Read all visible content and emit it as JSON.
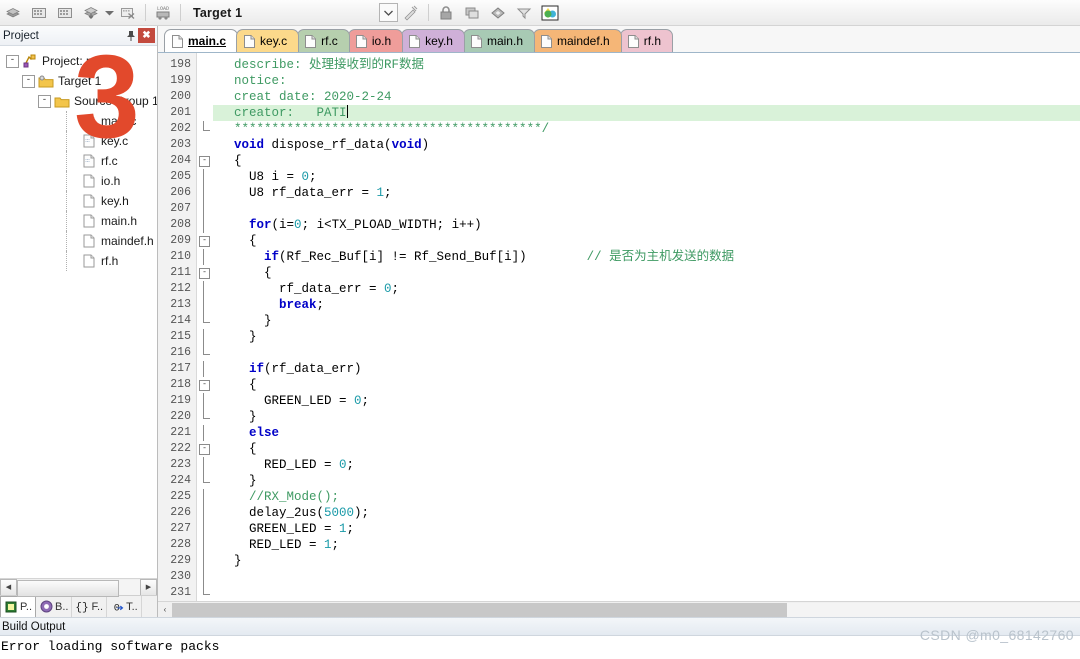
{
  "toolbar": {
    "icons": [
      {
        "name": "translate-icon",
        "glyph": "layers"
      },
      {
        "name": "build-target-icon",
        "glyph": "build"
      },
      {
        "name": "rebuild-icon",
        "glyph": "rebuild"
      },
      {
        "name": "batch-build-icon",
        "glyph": "batch"
      },
      {
        "name": "batch-build-dropdown-icon",
        "glyph": "caret"
      },
      {
        "name": "stop-build-icon",
        "glyph": "stop"
      },
      {
        "name": "download-icon",
        "glyph": "LOAD"
      }
    ],
    "target_label": "Target 1",
    "combo_arrow_icon": "chevron-down-icon",
    "right_icons": [
      {
        "name": "target-options-icon",
        "glyph": "magic"
      },
      {
        "name": "manage-project-items-icon",
        "glyph": "lock"
      },
      {
        "name": "manage-components-icon",
        "glyph": "windows"
      },
      {
        "name": "pack-installer-icon",
        "glyph": "diamond"
      },
      {
        "name": "configure-flash-icon",
        "glyph": "funnel"
      },
      {
        "name": "events-viewer-icon",
        "glyph": "globe"
      }
    ]
  },
  "project_panel": {
    "title": "Project",
    "pin_icon": "pin-icon",
    "close_label": "✖",
    "tree": [
      {
        "label": "Project: main",
        "level": 1,
        "expander": "-",
        "icon": "project-icon"
      },
      {
        "label": "Target 1",
        "level": 2,
        "expander": "-",
        "icon": "target-folder-icon"
      },
      {
        "label": "Source Group 1",
        "level": 3,
        "expander": "-",
        "icon": "folder-icon"
      },
      {
        "label": "main.c",
        "level": 4,
        "expander": "",
        "icon": "c-file-icon"
      },
      {
        "label": "key.c",
        "level": 4,
        "expander": "",
        "icon": "c-file-icon"
      },
      {
        "label": "rf.c",
        "level": 4,
        "expander": "",
        "icon": "c-file-icon"
      },
      {
        "label": "io.h",
        "level": 4,
        "expander": "",
        "icon": "h-file-icon"
      },
      {
        "label": "key.h",
        "level": 4,
        "expander": "",
        "icon": "h-file-icon"
      },
      {
        "label": "main.h",
        "level": 4,
        "expander": "",
        "icon": "h-file-icon"
      },
      {
        "label": "maindef.h",
        "level": 4,
        "expander": "",
        "icon": "h-file-icon"
      },
      {
        "label": "rf.h",
        "level": 4,
        "expander": "",
        "icon": "h-file-icon"
      }
    ],
    "bottom_tabs": [
      {
        "label": "P..",
        "name": "project-tab",
        "active": true,
        "icon": "project-small-icon"
      },
      {
        "label": "B..",
        "name": "books-tab",
        "active": false,
        "icon": "books-icon"
      },
      {
        "label": "F..",
        "name": "functions-tab",
        "active": false,
        "icon": "braces-icon"
      },
      {
        "label": "T..",
        "name": "templates-tab",
        "active": false,
        "icon": "template-icon"
      }
    ],
    "scroll_left_arrow": "◀",
    "scroll_right_arrow": "▶"
  },
  "editor": {
    "tabs": [
      {
        "label": "main.c",
        "color": "#ffffff",
        "active": true
      },
      {
        "label": "key.c",
        "color": "#fcd98b",
        "active": false
      },
      {
        "label": "rf.c",
        "color": "#b6cfae",
        "active": false
      },
      {
        "label": "io.h",
        "color": "#ef9d9a",
        "active": false
      },
      {
        "label": "key.h",
        "color": "#cfb0d8",
        "active": false
      },
      {
        "label": "main.h",
        "color": "#a8cab4",
        "active": false
      },
      {
        "label": "maindef.h",
        "color": "#f5b677",
        "active": false
      },
      {
        "label": "rf.h",
        "color": "#eec3cf",
        "active": false
      }
    ],
    "first_line_number": 198,
    "lines": [
      {
        "n": 198,
        "fold": "",
        "current": false,
        "spans": [
          {
            "t": "  ",
            "s": "t"
          },
          {
            "t": "describe: 处理接收到的RF数据",
            "s": "c"
          }
        ]
      },
      {
        "n": 199,
        "fold": "",
        "current": false,
        "spans": [
          {
            "t": "  ",
            "s": "t"
          },
          {
            "t": "notice:",
            "s": "c"
          }
        ]
      },
      {
        "n": 200,
        "fold": "",
        "current": false,
        "spans": [
          {
            "t": "  ",
            "s": "t"
          },
          {
            "t": "creat date: 2020-2-24",
            "s": "c"
          }
        ]
      },
      {
        "n": 201,
        "fold": "",
        "current": true,
        "spans": [
          {
            "t": "  ",
            "s": "t"
          },
          {
            "t": "creator:   PATI",
            "s": "c"
          },
          {
            "t": "|cursor|",
            "s": "cursor"
          }
        ]
      },
      {
        "n": 202,
        "fold": "end",
        "current": false,
        "spans": [
          {
            "t": "  ",
            "s": "t"
          },
          {
            "t": "*****************************************/",
            "s": "c"
          }
        ]
      },
      {
        "n": 203,
        "fold": "",
        "current": false,
        "spans": [
          {
            "t": "  ",
            "s": "t"
          },
          {
            "t": "void",
            "s": "k"
          },
          {
            "t": " dispose_rf_data(",
            "s": "t"
          },
          {
            "t": "void",
            "s": "k"
          },
          {
            "t": ")",
            "s": "t"
          }
        ]
      },
      {
        "n": 204,
        "fold": "box",
        "current": false,
        "spans": [
          {
            "t": "  {",
            "s": "t"
          }
        ]
      },
      {
        "n": 205,
        "fold": "bar",
        "current": false,
        "spans": [
          {
            "t": "    U8 i = ",
            "s": "t"
          },
          {
            "t": "0",
            "s": "n"
          },
          {
            "t": ";",
            "s": "t"
          }
        ]
      },
      {
        "n": 206,
        "fold": "bar",
        "current": false,
        "spans": [
          {
            "t": "    U8 rf_data_err = ",
            "s": "t"
          },
          {
            "t": "1",
            "s": "n"
          },
          {
            "t": ";",
            "s": "t"
          }
        ]
      },
      {
        "n": 207,
        "fold": "bar",
        "current": false,
        "spans": []
      },
      {
        "n": 208,
        "fold": "bar",
        "current": false,
        "spans": [
          {
            "t": "    ",
            "s": "t"
          },
          {
            "t": "for",
            "s": "k"
          },
          {
            "t": "(i=",
            "s": "t"
          },
          {
            "t": "0",
            "s": "n"
          },
          {
            "t": "; i<TX_PLOAD_WIDTH; i++)",
            "s": "t"
          }
        ]
      },
      {
        "n": 209,
        "fold": "box",
        "current": false,
        "spans": [
          {
            "t": "    {",
            "s": "t"
          }
        ]
      },
      {
        "n": 210,
        "fold": "bar",
        "current": false,
        "spans": [
          {
            "t": "      ",
            "s": "t"
          },
          {
            "t": "if",
            "s": "k"
          },
          {
            "t": "(Rf_Rec_Buf[i] != Rf_Send_Buf[i])        ",
            "s": "t"
          },
          {
            "t": "// 是否为主机发送的数据",
            "s": "c"
          }
        ]
      },
      {
        "n": 211,
        "fold": "box",
        "current": false,
        "spans": [
          {
            "t": "      {",
            "s": "t"
          }
        ]
      },
      {
        "n": 212,
        "fold": "bar",
        "current": false,
        "spans": [
          {
            "t": "        rf_data_err = ",
            "s": "t"
          },
          {
            "t": "0",
            "s": "n"
          },
          {
            "t": ";",
            "s": "t"
          }
        ]
      },
      {
        "n": 213,
        "fold": "bar",
        "current": false,
        "spans": [
          {
            "t": "        ",
            "s": "t"
          },
          {
            "t": "break",
            "s": "k"
          },
          {
            "t": ";",
            "s": "t"
          }
        ]
      },
      {
        "n": 214,
        "fold": "end",
        "current": false,
        "spans": [
          {
            "t": "      }",
            "s": "t"
          }
        ]
      },
      {
        "n": 215,
        "fold": "bar",
        "current": false,
        "spans": [
          {
            "t": "    }",
            "s": "t"
          }
        ]
      },
      {
        "n": 216,
        "fold": "end",
        "current": false,
        "spans": []
      },
      {
        "n": 217,
        "fold": "bar",
        "current": false,
        "spans": [
          {
            "t": "    ",
            "s": "t"
          },
          {
            "t": "if",
            "s": "k"
          },
          {
            "t": "(rf_data_err)",
            "s": "t"
          }
        ]
      },
      {
        "n": 218,
        "fold": "box",
        "current": false,
        "spans": [
          {
            "t": "    {",
            "s": "t"
          }
        ]
      },
      {
        "n": 219,
        "fold": "bar",
        "current": false,
        "spans": [
          {
            "t": "      GREEN_LED = ",
            "s": "t"
          },
          {
            "t": "0",
            "s": "n"
          },
          {
            "t": ";",
            "s": "t"
          }
        ]
      },
      {
        "n": 220,
        "fold": "end",
        "current": false,
        "spans": [
          {
            "t": "    }",
            "s": "t"
          }
        ]
      },
      {
        "n": 221,
        "fold": "bar",
        "current": false,
        "spans": [
          {
            "t": "    ",
            "s": "t"
          },
          {
            "t": "else",
            "s": "k"
          }
        ]
      },
      {
        "n": 222,
        "fold": "box",
        "current": false,
        "spans": [
          {
            "t": "    {",
            "s": "t"
          }
        ]
      },
      {
        "n": 223,
        "fold": "bar",
        "current": false,
        "spans": [
          {
            "t": "      RED_LED = ",
            "s": "t"
          },
          {
            "t": "0",
            "s": "n"
          },
          {
            "t": ";",
            "s": "t"
          }
        ]
      },
      {
        "n": 224,
        "fold": "end",
        "current": false,
        "spans": [
          {
            "t": "    }",
            "s": "t"
          }
        ]
      },
      {
        "n": 225,
        "fold": "bar",
        "current": false,
        "spans": [
          {
            "t": "    ",
            "s": "t"
          },
          {
            "t": "//RX_Mode();",
            "s": "c"
          }
        ]
      },
      {
        "n": 226,
        "fold": "bar",
        "current": false,
        "spans": [
          {
            "t": "    delay_2us(",
            "s": "t"
          },
          {
            "t": "5000",
            "s": "n"
          },
          {
            "t": ");",
            "s": "t"
          }
        ]
      },
      {
        "n": 227,
        "fold": "bar",
        "current": false,
        "spans": [
          {
            "t": "    GREEN_LED = ",
            "s": "t"
          },
          {
            "t": "1",
            "s": "n"
          },
          {
            "t": ";",
            "s": "t"
          }
        ]
      },
      {
        "n": 228,
        "fold": "bar",
        "current": false,
        "spans": [
          {
            "t": "    RED_LED = ",
            "s": "t"
          },
          {
            "t": "1",
            "s": "n"
          },
          {
            "t": ";",
            "s": "t"
          }
        ]
      },
      {
        "n": 229,
        "fold": "bar",
        "current": false,
        "spans": [
          {
            "t": "  }",
            "s": "t"
          }
        ]
      },
      {
        "n": 230,
        "fold": "bar",
        "current": false,
        "spans": []
      },
      {
        "n": 231,
        "fold": "end",
        "current": false,
        "spans": []
      }
    ],
    "hscroll_left_arrow": "‹"
  },
  "build_output": {
    "title": "Build Output",
    "text": "Error loading software packs"
  },
  "annotations": {
    "step_number": "3",
    "watermark": "CSDN @m0_68142760"
  },
  "colors": {
    "current_line": "#d9f2d9",
    "comment": "#3f9a63",
    "keyword": "#0000c8",
    "number": "#1a9aa8",
    "annotation": "#e2492c",
    "close_button": "#c34a3e"
  }
}
